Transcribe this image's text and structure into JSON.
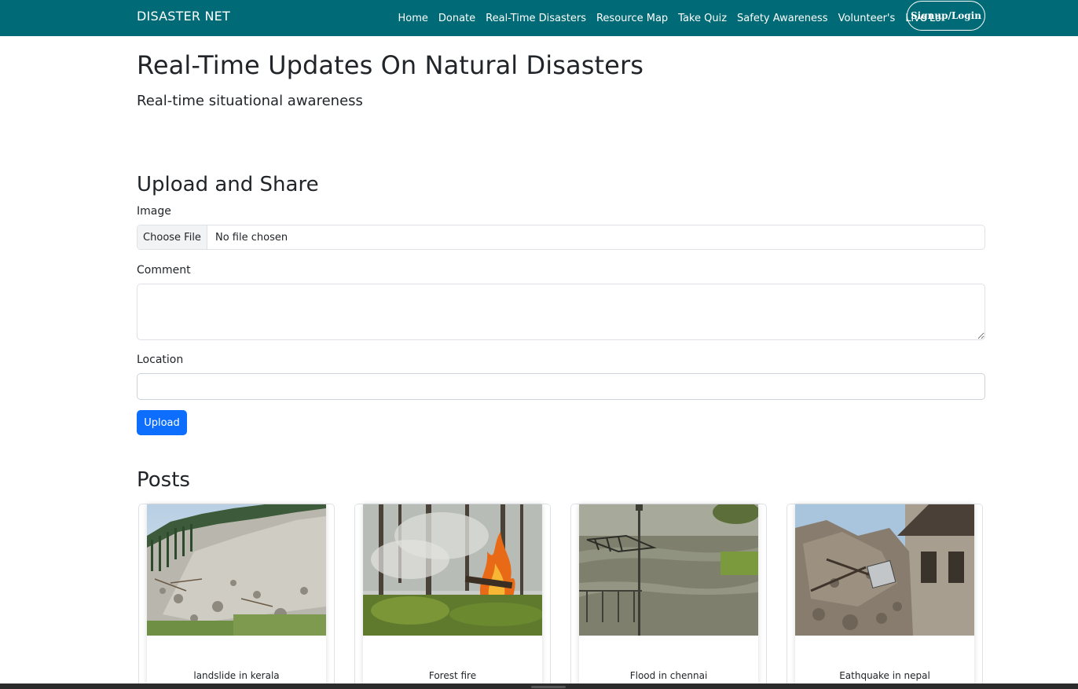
{
  "navbar": {
    "brand": "DISASTER NET",
    "links": [
      "Home",
      "Donate",
      "Real-Time Disasters",
      "Resource Map",
      "Take Quiz",
      "Safety Awareness",
      "Volunteer's",
      "Live Loc"
    ],
    "login_label": "Signup/Login",
    "bg_color": "#006b76"
  },
  "page": {
    "title": "Real-Time Updates On Natural Disasters",
    "subtitle": "Real-time situational awareness"
  },
  "upload": {
    "heading": "Upload and Share",
    "image_label": "Image",
    "choose_file_label": "Choose File",
    "file_status": "No file chosen",
    "comment_label": "Comment",
    "comment_value": "",
    "location_label": "Location",
    "location_value": "",
    "upload_button": "Upload",
    "button_color": "#0d6efd"
  },
  "posts": {
    "heading": "Posts",
    "items": [
      {
        "caption": "landslide in kerala",
        "image": "landslide-photo"
      },
      {
        "caption": "Forest fire",
        "image": "forest-fire-photo"
      },
      {
        "caption": "Flood in chennai",
        "image": "flood-photo"
      },
      {
        "caption": "Eathquake in nepal",
        "image": "earthquake-photo"
      }
    ]
  }
}
